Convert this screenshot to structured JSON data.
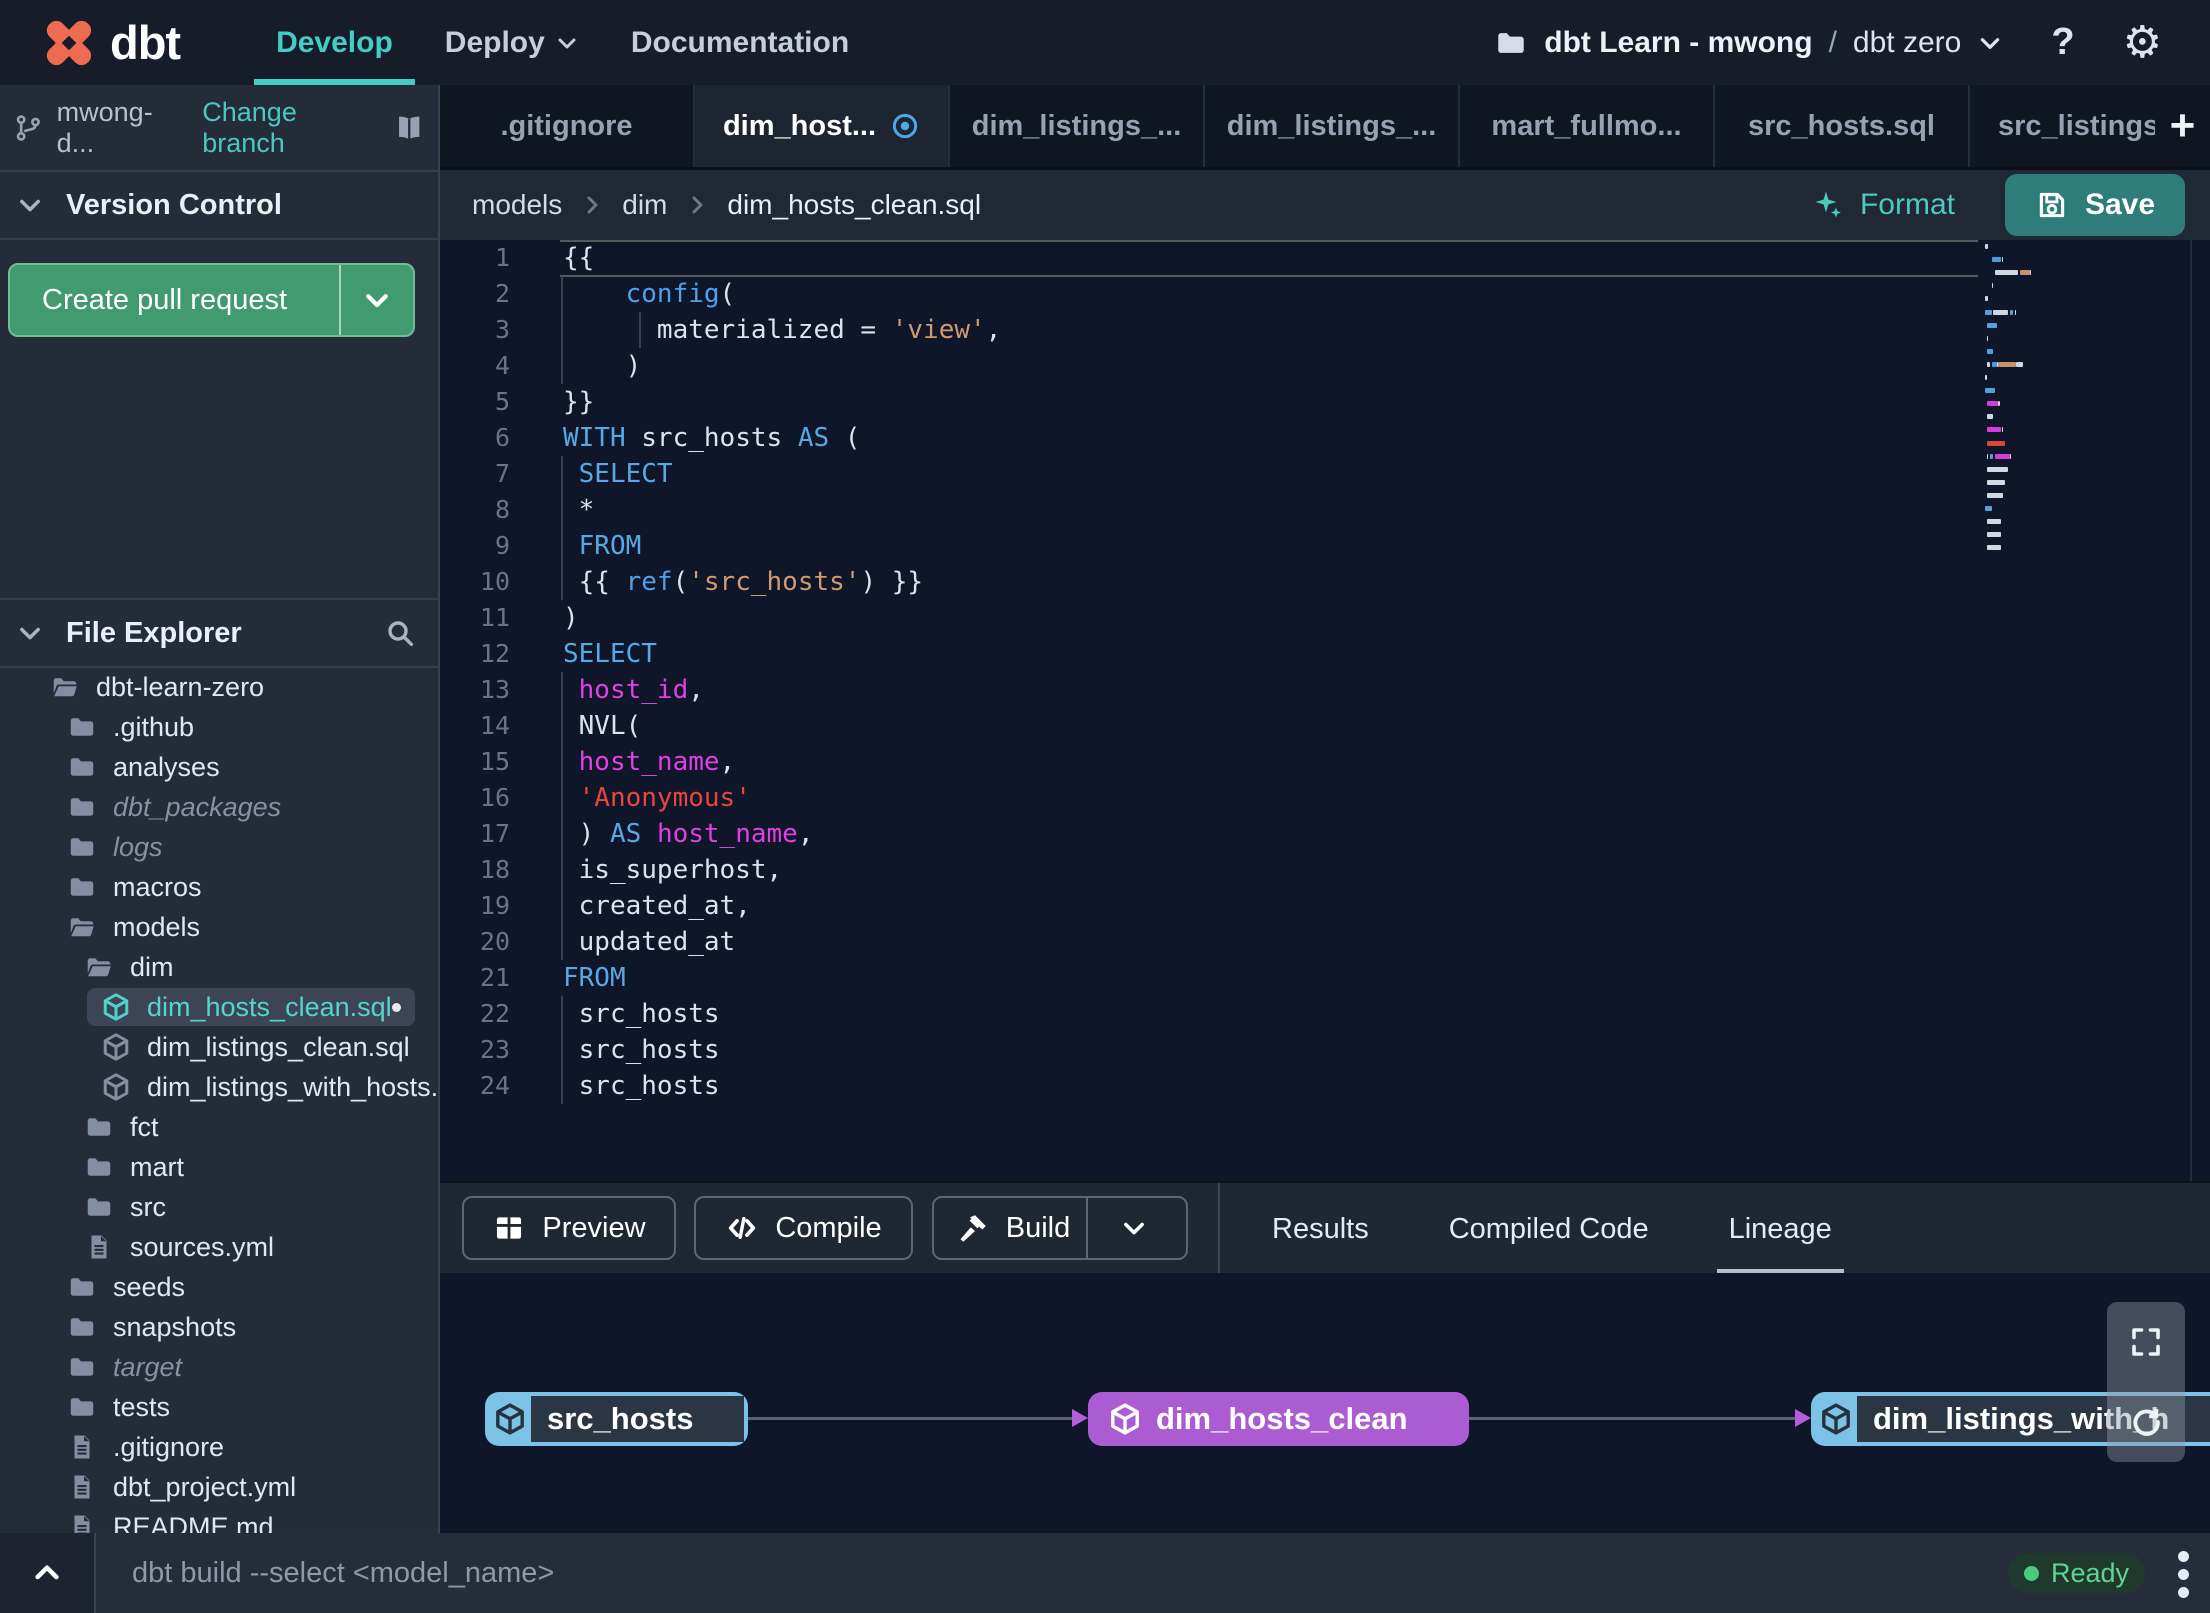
{
  "colors": {
    "accent_teal": "#43cdc4",
    "logo_orange": "#ee6a50",
    "pr_green": "#419b6f",
    "save_teal": "#2f7d7a",
    "node_purple": "#ab5cd3",
    "node_sky": "#7cc2e6",
    "status_green": "#5ed591",
    "tab_dot_blue": "#4aa9e8"
  },
  "navbar": {
    "brand": "dbt",
    "items": [
      {
        "label": "Develop",
        "active": true,
        "chevron": false
      },
      {
        "label": "Deploy",
        "active": false,
        "chevron": true
      },
      {
        "label": "Documentation",
        "active": false,
        "chevron": false
      }
    ],
    "project": {
      "account": "dbt Learn - mwong",
      "separator": "/",
      "name": "dbt zero"
    },
    "help_label": "?",
    "gear_glyph": "⚙"
  },
  "branch_bar": {
    "branch": "mwong-d...",
    "change_branch": "Change branch"
  },
  "version_control": {
    "title": "Version Control",
    "create_pr_label": "Create pull request"
  },
  "file_explorer": {
    "title": "File Explorer",
    "tree": [
      {
        "label": "dbt-learn-zero",
        "type": "folder-open",
        "depth": 0
      },
      {
        "label": ".github",
        "type": "folder",
        "depth": 1
      },
      {
        "label": "analyses",
        "type": "folder",
        "depth": 1
      },
      {
        "label": "dbt_packages",
        "type": "folder",
        "depth": 1,
        "italic": true
      },
      {
        "label": "logs",
        "type": "folder",
        "depth": 1,
        "italic": true
      },
      {
        "label": "macros",
        "type": "folder",
        "depth": 1
      },
      {
        "label": "models",
        "type": "folder-open",
        "depth": 1
      },
      {
        "label": "dim",
        "type": "folder-open",
        "depth": 2
      },
      {
        "label": "dim_hosts_clean.sql",
        "type": "model",
        "depth": 3,
        "selected": true,
        "modified": true
      },
      {
        "label": "dim_listings_clean.sql",
        "type": "model",
        "depth": 3
      },
      {
        "label": "dim_listings_with_hosts...",
        "type": "model",
        "depth": 3
      },
      {
        "label": "fct",
        "type": "folder",
        "depth": 2
      },
      {
        "label": "mart",
        "type": "folder",
        "depth": 2
      },
      {
        "label": "src",
        "type": "folder",
        "depth": 2
      },
      {
        "label": "sources.yml",
        "type": "file",
        "depth": 2
      },
      {
        "label": "seeds",
        "type": "folder",
        "depth": 1
      },
      {
        "label": "snapshots",
        "type": "folder",
        "depth": 1
      },
      {
        "label": "target",
        "type": "folder",
        "depth": 1,
        "italic": true
      },
      {
        "label": "tests",
        "type": "folder",
        "depth": 1
      },
      {
        "label": ".gitignore",
        "type": "file",
        "depth": 1
      },
      {
        "label": "dbt_project.yml",
        "type": "file",
        "depth": 1
      },
      {
        "label": "README.md",
        "type": "file",
        "depth": 1
      }
    ]
  },
  "tabs": [
    {
      "label": ".gitignore"
    },
    {
      "label": "dim_host...",
      "active": true,
      "modified": true
    },
    {
      "label": "dim_listings_..."
    },
    {
      "label": "dim_listings_..."
    },
    {
      "label": "mart_fullmo..."
    },
    {
      "label": "src_hosts.sql"
    },
    {
      "label": "src_listings.",
      "clipped": true
    }
  ],
  "editor": {
    "breadcrumb": [
      "models",
      "dim",
      "dim_hosts_clean.sql"
    ],
    "format_label": "Format",
    "save_label": "Save",
    "palette": {
      "fg": "#dce3ee",
      "kw": "#56a9e2",
      "fn": "#4fa0e8",
      "str": "#cf9a72",
      "err": "#e5483b",
      "ident": "#df40df"
    },
    "lines": [
      {
        "current": true,
        "g": [],
        "segments": [
          {
            "t": "{{",
            "c": "fg"
          }
        ]
      },
      {
        "g": [
          0
        ],
        "segments": [
          {
            "t": "    ",
            "c": "fg"
          },
          {
            "t": "config",
            "c": "fn"
          },
          {
            "t": "(",
            "c": "fg"
          }
        ]
      },
      {
        "g": [
          0,
          5
        ],
        "segments": [
          {
            "t": "      materialized = ",
            "c": "fg"
          },
          {
            "t": "'view'",
            "c": "str"
          },
          {
            "t": ",",
            "c": "fg"
          }
        ]
      },
      {
        "g": [
          0
        ],
        "segments": [
          {
            "t": "    )",
            "c": "fg"
          }
        ]
      },
      {
        "g": [],
        "segments": [
          {
            "t": "}}",
            "c": "fg"
          }
        ]
      },
      {
        "g": [],
        "segments": [
          {
            "t": "WITH",
            "c": "kw"
          },
          {
            "t": " src_hosts ",
            "c": "fg"
          },
          {
            "t": "AS",
            "c": "kw"
          },
          {
            "t": " (",
            "c": "fg"
          }
        ]
      },
      {
        "g": [
          0
        ],
        "segments": [
          {
            "t": " ",
            "c": "fg"
          },
          {
            "t": "SELECT",
            "c": "kw"
          }
        ]
      },
      {
        "g": [
          0
        ],
        "segments": [
          {
            "t": " *",
            "c": "fg"
          }
        ]
      },
      {
        "g": [
          0
        ],
        "segments": [
          {
            "t": " ",
            "c": "fg"
          },
          {
            "t": "FROM",
            "c": "kw"
          }
        ]
      },
      {
        "g": [
          0
        ],
        "segments": [
          {
            "t": " {{ ",
            "c": "fg"
          },
          {
            "t": "ref",
            "c": "fn"
          },
          {
            "t": "(",
            "c": "fg"
          },
          {
            "t": "'src_hosts'",
            "c": "str"
          },
          {
            "t": ") }}",
            "c": "fg"
          }
        ]
      },
      {
        "g": [],
        "segments": [
          {
            "t": ")",
            "c": "fg"
          }
        ]
      },
      {
        "g": [],
        "segments": [
          {
            "t": "SELECT",
            "c": "kw"
          }
        ]
      },
      {
        "g": [
          0
        ],
        "segments": [
          {
            "t": " ",
            "c": "fg"
          },
          {
            "t": "host_id",
            "c": "ident"
          },
          {
            "t": ",",
            "c": "fg"
          }
        ]
      },
      {
        "g": [
          0
        ],
        "segments": [
          {
            "t": " NVL(",
            "c": "fg"
          }
        ]
      },
      {
        "g": [
          0
        ],
        "segments": [
          {
            "t": " ",
            "c": "fg"
          },
          {
            "t": "host_name",
            "c": "ident"
          },
          {
            "t": ",",
            "c": "fg"
          }
        ]
      },
      {
        "g": [
          0
        ],
        "segments": [
          {
            "t": " ",
            "c": "fg"
          },
          {
            "t": "'Anonymous'",
            "c": "err"
          }
        ]
      },
      {
        "g": [
          0
        ],
        "segments": [
          {
            "t": " ) ",
            "c": "fg"
          },
          {
            "t": "AS",
            "c": "kw"
          },
          {
            "t": " ",
            "c": "fg"
          },
          {
            "t": "host_name",
            "c": "ident"
          },
          {
            "t": ",",
            "c": "fg"
          }
        ]
      },
      {
        "g": [
          0
        ],
        "segments": [
          {
            "t": " is_superhost,",
            "c": "fg"
          }
        ]
      },
      {
        "g": [
          0
        ],
        "segments": [
          {
            "t": " created_at,",
            "c": "fg"
          }
        ]
      },
      {
        "g": [
          0
        ],
        "segments": [
          {
            "t": " updated_at",
            "c": "fg"
          }
        ]
      },
      {
        "g": [],
        "segments": [
          {
            "t": "FROM",
            "c": "kw"
          }
        ]
      },
      {
        "g": [
          0
        ],
        "segments": [
          {
            "t": " src_hosts",
            "c": "fg"
          }
        ]
      },
      {
        "g": [
          0
        ],
        "segments": [
          {
            "t": " src_hosts",
            "c": "fg"
          }
        ]
      },
      {
        "g": [
          0
        ],
        "segments": [
          {
            "t": " src_hosts",
            "c": "fg"
          }
        ]
      }
    ]
  },
  "bottom_toolbar": {
    "buttons": [
      {
        "label": "Preview",
        "icon": "table"
      },
      {
        "label": "Compile",
        "icon": "code"
      },
      {
        "label": "Build",
        "icon": "hammer",
        "split": true
      }
    ],
    "tabs": [
      {
        "label": "Results"
      },
      {
        "label": "Compiled Code"
      },
      {
        "label": "Lineage",
        "active": true
      }
    ]
  },
  "lineage": {
    "nodes": [
      {
        "label": "src_hosts",
        "variant": "source"
      },
      {
        "label": "dim_hosts_clean",
        "variant": "model"
      },
      {
        "label": "dim_listings_with_h",
        "variant": "source",
        "clipped": true
      }
    ]
  },
  "command_bar": {
    "placeholder": "dbt build --select <model_name>",
    "status": "Ready"
  }
}
